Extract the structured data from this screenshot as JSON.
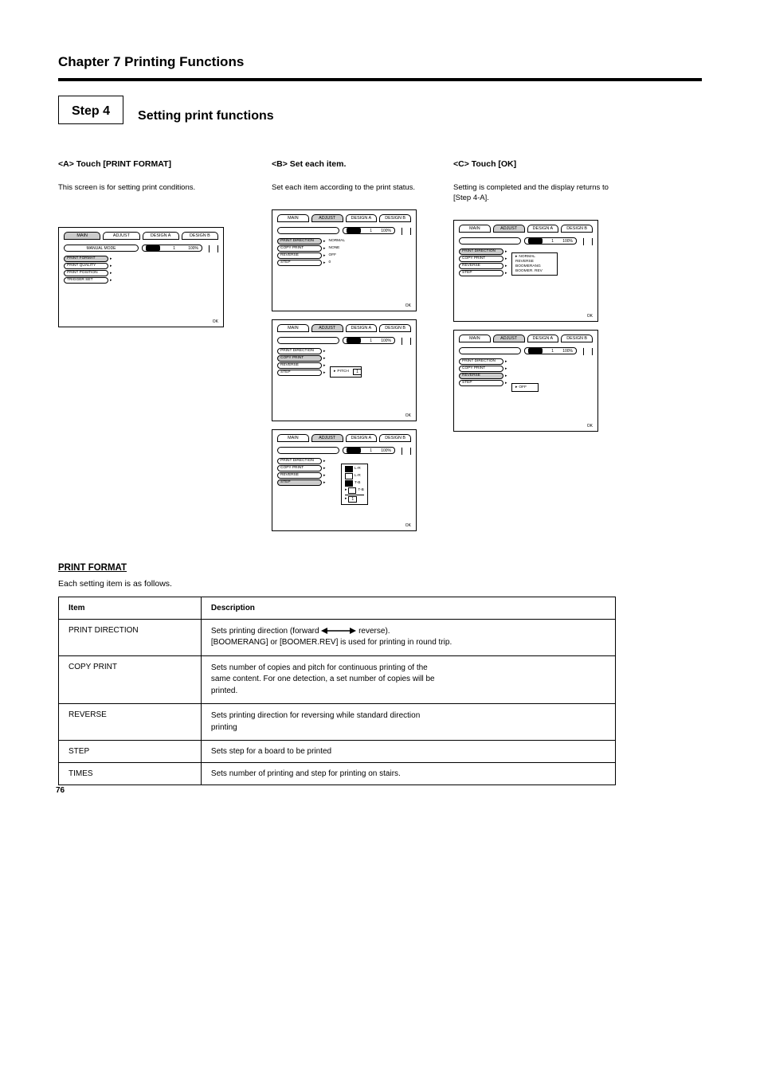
{
  "chapter": "Chapter 7 Printing Functions",
  "step4": {
    "label": "Step 4",
    "title": "Setting print functions"
  },
  "sub_a": {
    "title": "<A> Touch [PRINT FORMAT]",
    "body": "This screen is for setting print conditions.",
    "screen": {
      "tabs": [
        "MAIN",
        "ADJUST",
        "DESIGN A",
        "DESIGN B"
      ],
      "active_tab": 0,
      "mode": "MANUAL MODE",
      "slider": {
        "cur": "1",
        "max": "100%"
      },
      "rows": [
        {
          "label": "PRINT FORMAT",
          "sel": true
        },
        {
          "label": "PRINT QUALITY"
        },
        {
          "label": "PRINT POSITION"
        },
        {
          "label": "TRIGGER SET"
        }
      ],
      "ok": "OK"
    }
  },
  "sub_b": {
    "title": "<B> Set each item.",
    "body": "Set each item according to the print status.",
    "screens": [
      {
        "tabs": [
          "MAIN",
          "ADJUST",
          "DESIGN A",
          "DESIGN B"
        ],
        "active_tab": 1,
        "slider": {
          "cur": "1",
          "max": "100%"
        },
        "rows": [
          {
            "label": "PRINT DIRECTION",
            "sel": true
          },
          {
            "label": "COPY PRINT"
          },
          {
            "label": "REVERSE"
          },
          {
            "label": "STEP"
          }
        ],
        "values": {
          "direction": "NORMAL",
          "copy": "NONE",
          "reverse": "OFF",
          "step": "0"
        },
        "ok": "OK"
      },
      {
        "tabs": [
          "MAIN",
          "ADJUST",
          "DESIGN A",
          "DESIGN B"
        ],
        "active_tab": 1,
        "slider": {
          "cur": "1",
          "max": "100%"
        },
        "rows": [
          {
            "label": "PRINT DIRECTION"
          },
          {
            "label": "COPY PRINT",
            "sel": true
          },
          {
            "label": "REVERSE"
          },
          {
            "label": "STEP"
          }
        ],
        "popup": {
          "field": "PITCH",
          "value": "1"
        },
        "ok": "OK"
      },
      {
        "tabs": [
          "MAIN",
          "ADJUST",
          "DESIGN A",
          "DESIGN B"
        ],
        "active_tab": 1,
        "slider": {
          "cur": "1",
          "max": "100%"
        },
        "rows": [
          {
            "label": "PRINT DIRECTION"
          },
          {
            "label": "COPY PRINT"
          },
          {
            "label": "REVERSE"
          },
          {
            "label": "STEP",
            "sel": true
          }
        ],
        "popup_colors": {
          "rows": [
            {
              "color": "black",
              "label": "L-R",
              "sel": false
            },
            {
              "color": "white",
              "label": "L-R",
              "sel": true
            },
            {
              "color": "black",
              "label": "T-B"
            },
            {
              "color": "white",
              "label": "T-B"
            }
          ],
          "footer": "1"
        },
        "ok": "OK"
      }
    ]
  },
  "sub_c": {
    "title": "<C> Touch [OK]",
    "body": "Setting is completed and the display returns to [Step 4-A].",
    "screens": [
      {
        "tabs": [
          "MAIN",
          "ADJUST",
          "DESIGN A",
          "DESIGN B"
        ],
        "active_tab": 1,
        "slider": {
          "cur": "1",
          "max": "100%"
        },
        "rows": [
          {
            "label": "PRINT DIRECTION",
            "sel": true
          },
          {
            "label": "COPY PRINT"
          },
          {
            "label": "REVERSE"
          },
          {
            "label": "STEP"
          }
        ],
        "popup_list": [
          "NORMAL",
          "REVERSE",
          "BOOMERANG",
          "BOOMER. REV"
        ],
        "ok": "OK"
      },
      {
        "tabs": [
          "MAIN",
          "ADJUST",
          "DESIGN A",
          "DESIGN B"
        ],
        "active_tab": 1,
        "slider": {
          "cur": "1",
          "max": "100%"
        },
        "rows": [
          {
            "label": "PRINT DIRECTION"
          },
          {
            "label": "COPY PRINT"
          },
          {
            "label": "REVERSE",
            "sel": true
          },
          {
            "label": "STEP"
          }
        ],
        "popup_small": "OFF",
        "ok": "OK"
      }
    ]
  },
  "options": {
    "under": "PRINT FORMAT",
    "intro": "Each setting item is as follows.",
    "headers": [
      "Item",
      "Description"
    ],
    "rows": [
      {
        "item": "PRINT DIRECTION",
        "desc_lines": [
          "Sets printing direction (forward    reverse).",
          "[BOOMERANG] or [BOOMER.REV] is used for printing in round trip."
        ]
      },
      {
        "item": "COPY PRINT",
        "desc_lines": [
          "Sets number of copies and pitch for continuous printing of the",
          "same content. For one detection, a set number of copies will be",
          "printed."
        ]
      },
      {
        "item": "REVERSE",
        "desc_lines": [
          "Sets printing direction for reversing while standard direction",
          "printing"
        ]
      },
      {
        "item": "STEP",
        "desc_lines": [
          "Sets step for a board to be printed"
        ]
      },
      {
        "item": "TIMES",
        "desc_lines": [
          "Sets number of printing and step for printing on stairs."
        ]
      }
    ]
  },
  "page": "76"
}
